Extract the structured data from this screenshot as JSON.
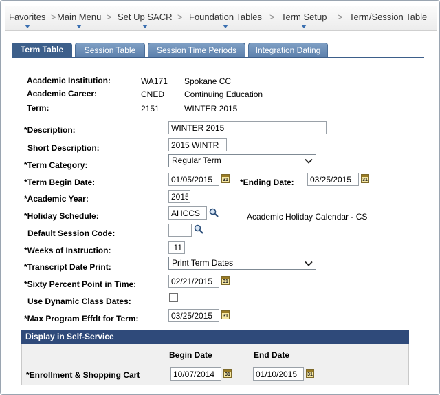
{
  "breadcrumb": {
    "items": [
      "Favorites",
      "Main Menu",
      "Set Up SACR",
      "Foundation Tables",
      "Term Setup",
      "Term/Session Table"
    ],
    "separator": ">"
  },
  "tabs": [
    {
      "label": "Term Table",
      "active": true
    },
    {
      "label": "Session Table",
      "active": false
    },
    {
      "label": "Session Time Periods",
      "active": false
    },
    {
      "label": "Integration Dating",
      "active": false
    }
  ],
  "header": {
    "institution_label": "Academic Institution:",
    "institution_code": "WA171",
    "institution_name": "Spokane CC",
    "career_label": "Academic Career:",
    "career_code": "CNED",
    "career_name": "Continuing Education",
    "term_label": "Term:",
    "term_code": "2151",
    "term_name": "WINTER 2015"
  },
  "form": {
    "description_label": "*Description:",
    "description_value": "WINTER 2015",
    "short_desc_label": "Short Description:",
    "short_desc_value": "2015 WINTR",
    "term_category_label": "*Term Category:",
    "term_category_value": "Regular Term",
    "term_begin_label": "*Term Begin Date:",
    "term_begin_value": "01/05/2015",
    "ending_date_label": "*Ending Date:",
    "ending_date_value": "03/25/2015",
    "academic_year_label": "*Academic Year:",
    "academic_year_value": "2015",
    "holiday_label": "*Holiday Schedule:",
    "holiday_value": "AHCCS",
    "holiday_desc": "Academic Holiday Calendar - CS",
    "default_session_label": "Default Session Code:",
    "default_session_value": "",
    "weeks_label": "*Weeks of Instruction:",
    "weeks_value": "11",
    "transcript_label": "*Transcript Date Print:",
    "transcript_value": "Print Term Dates",
    "sixty_label": "*Sixty Percent Point in Time:",
    "sixty_value": "02/21/2015",
    "dynamic_label": "Use Dynamic Class Dates:",
    "dynamic_checked": false,
    "max_program_label": "*Max Program Effdt for Term:",
    "max_program_value": "03/25/2015"
  },
  "self_service": {
    "title": "Display in Self-Service",
    "begin_header": "Begin Date",
    "end_header": "End Date",
    "enroll_label": "*Enrollment & Shopping Cart",
    "enroll_begin": "10/07/2014",
    "enroll_end": "01/10/2015"
  },
  "icons": {
    "calendar_text": "31"
  },
  "colors": {
    "tab_active": "#3d5f8a",
    "tab_inactive": "#6a8cb6",
    "group_header": "#2f4a7a",
    "nav_arrow": "#3a6fb0"
  }
}
